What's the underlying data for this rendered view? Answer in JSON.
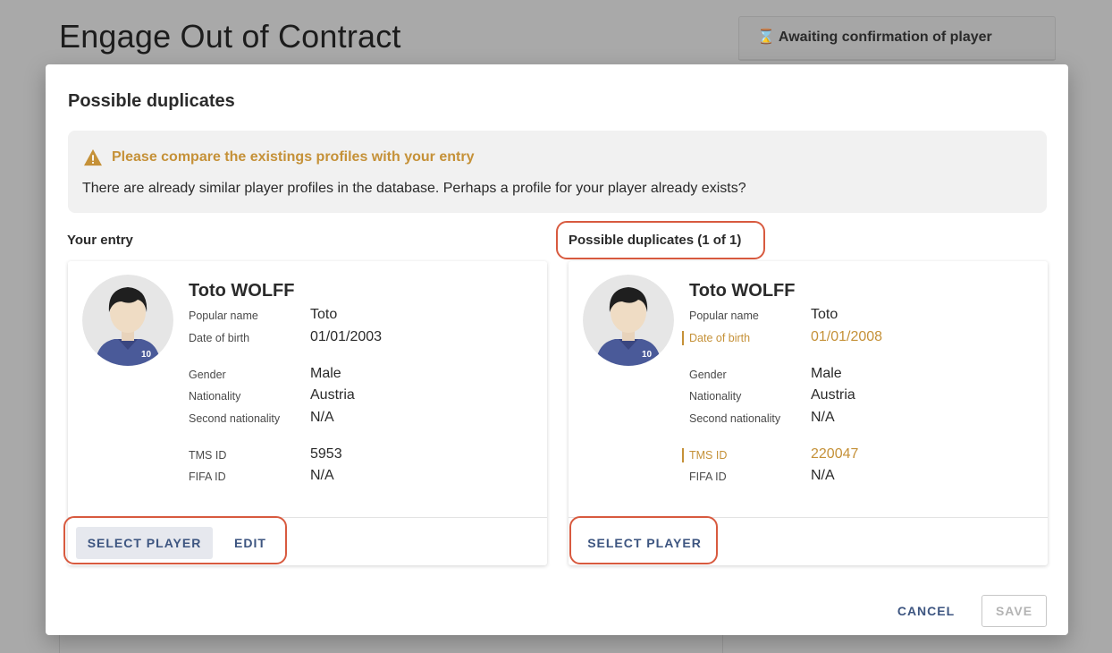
{
  "background": {
    "page_title": "Engage Out of Contract",
    "status_text": "Awaiting confirmation of player"
  },
  "dialog": {
    "title": "Possible duplicates",
    "alert": {
      "title": "Please compare the existings profiles with your entry",
      "text": "There are already similar player profiles in the database. Perhaps a profile for your player already exists?"
    },
    "left_section_label": "Your entry",
    "right_section_label": "Possible duplicates (1 of 1)",
    "labels": {
      "popular_name": "Popular name",
      "date_of_birth": "Date of birth",
      "gender": "Gender",
      "nationality": "Nationality",
      "second_nationality": "Second nationality",
      "tms_id": "TMS ID",
      "fifa_id": "FIFA ID"
    },
    "entry": {
      "name": "Toto WOLFF",
      "popular_name": "Toto",
      "date_of_birth": "01/01/2003",
      "gender": "Male",
      "nationality": "Austria",
      "second_nationality": "N/A",
      "tms_id": "5953",
      "fifa_id": "N/A",
      "jersey_number": "10",
      "select_label": "SELECT PLAYER",
      "edit_label": "EDIT"
    },
    "duplicate": {
      "name": "Toto WOLFF",
      "popular_name": "Toto",
      "date_of_birth": "01/01/2008",
      "gender": "Male",
      "nationality": "Austria",
      "second_nationality": "N/A",
      "tms_id": "220047",
      "fifa_id": "N/A",
      "jersey_number": "10",
      "select_label": "SELECT PLAYER"
    },
    "cancel_label": "CANCEL",
    "save_label": "SAVE"
  },
  "colors": {
    "accent": "#3d5580",
    "warning": "#c59138",
    "highlight": "#d85a3f"
  }
}
